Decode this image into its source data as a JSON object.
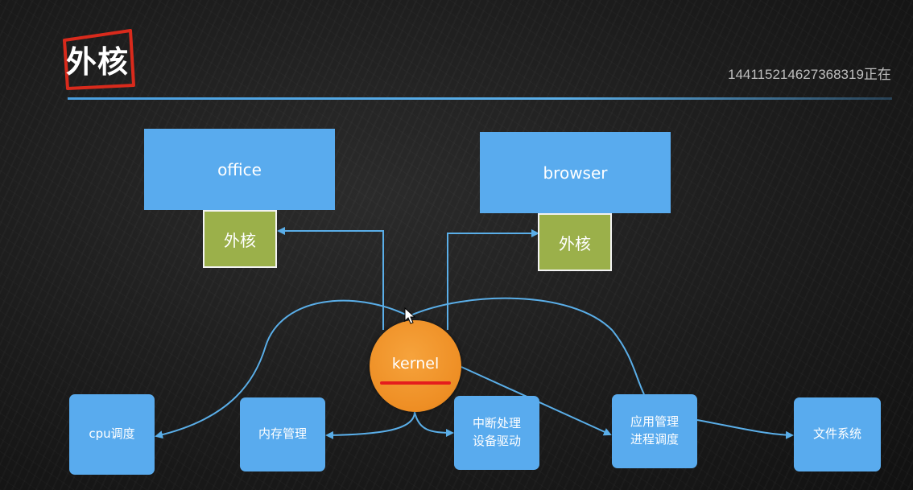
{
  "title": "外核",
  "watermark": "144115214627368319正在",
  "apps": {
    "office": "office",
    "browser": "browser"
  },
  "shells": {
    "left": "外核",
    "right": "外核"
  },
  "kernel": "kernel",
  "modules": {
    "cpu": "cpu调度",
    "memory": "内存管理",
    "interrupt": "中断处理\n设备驱动",
    "app_process": "应用管理\n进程调度",
    "filesystem": "文件系统"
  },
  "colors": {
    "box_blue": "#59abee",
    "shell_green": "#9bb04a",
    "kernel_orange": "#ee8e24",
    "underline_red": "#e51d1d",
    "line_blue": "#5aaee8"
  }
}
